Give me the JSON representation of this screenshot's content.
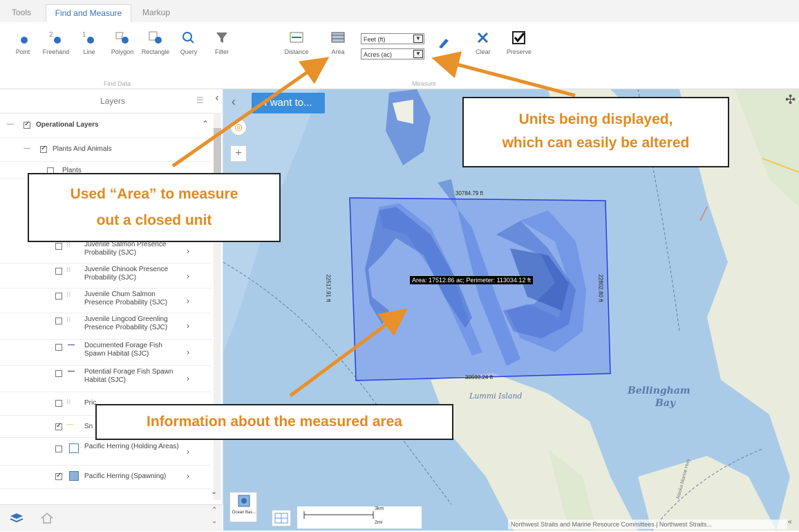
{
  "tabs": [
    {
      "label": "Tools"
    },
    {
      "label": "Find and Measure"
    },
    {
      "label": "Markup"
    }
  ],
  "ribbon": {
    "find_tools": [
      "Point",
      "Freehand",
      "Line",
      "Polygon",
      "Rectangle",
      "Query",
      "Filter"
    ],
    "find_group_label": "Find Data",
    "measure_tools": [
      "Distance",
      "Area"
    ],
    "length_unit": "Feet (ft)",
    "area_unit": "Acres (ac)",
    "clear_label": "Clear",
    "preserve_label": "Preserve",
    "measure_group_label": "Measure"
  },
  "layers": {
    "title": "Layers",
    "items": [
      {
        "label": "Operational Layers",
        "checked": true
      },
      {
        "label": "Plants And Animals",
        "checked": true
      },
      {
        "label": "Plants",
        "checked": false
      },
      {
        "label": "Juvenile Salmon Presence Probability (SJC)",
        "checked": false
      },
      {
        "label": "Juvenile Chinook Presence Probability (SJC)",
        "checked": false
      },
      {
        "label": "Juvenile Chum Salmon Presence Probability (SJC)",
        "checked": false
      },
      {
        "label": "Juvenile Lingcod Greenling Presence Probability (SJC)",
        "checked": false
      },
      {
        "label": "Documented Forage Fish Spawn Habitat (SJC)",
        "checked": false
      },
      {
        "label": "Potential Forage Fish Spawn Habitat (SJC)",
        "checked": false
      },
      {
        "label": "Pric",
        "checked": false
      },
      {
        "label": "Sn",
        "checked": true
      },
      {
        "label": "Pacific Herring (Holding Areas)",
        "checked": false
      },
      {
        "label": "Pacific Herring (Spawning)",
        "checked": true
      }
    ]
  },
  "map": {
    "i_want_to": "I want to...",
    "measure_tooltip": "Area: 17512.86 ac; Perimeter: 113034.12 ft",
    "top_edge": "30784.79 ft",
    "bottom_edge": "30593.24 ft",
    "left_edge": "22517.91 ft",
    "right_edge": "22802.80 ft",
    "place_lummi": "Lummi Island",
    "place_bellingham_1": "Bellingham",
    "place_bellingham_2": "Bay",
    "road_label": "Alaska Marine Hwy",
    "basemap_label": "Ocean Bas...",
    "scale_km": "3km",
    "scale_mi": "2mi",
    "attribution": "Northwest Straits and Marine Resource Committees | Northwest Straits..."
  },
  "callouts": {
    "units_line1": "Units being displayed,",
    "units_line2": "which can easily be altered",
    "area_line1": "Used “Area” to measure",
    "area_line2": "out a closed unit",
    "info": "Information about the measured area"
  },
  "colors": {
    "accent": "#3b8edb",
    "callout_text": "#e08a20",
    "arrow": "#e8902a",
    "measure_fill": "#6a8cf0",
    "measure_stroke": "#2a3fd6",
    "water": "#a9cbe8",
    "land": "#e9ecdc"
  }
}
